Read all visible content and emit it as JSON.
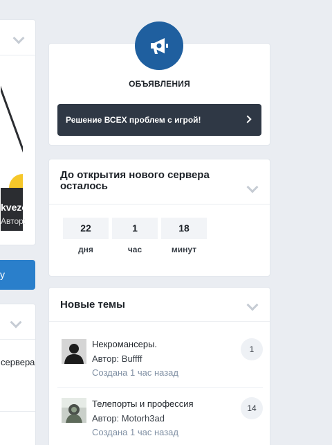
{
  "left_column": {
    "top_card": {
      "caption": "kvezo",
      "subcaption": "Автор:"
    },
    "button": {
      "label": "у"
    },
    "bottom_card": {
      "line1": "сервера",
      "line2": ""
    }
  },
  "announcements": {
    "icon": "megaphone-icon",
    "title": "ОБЪЯВЛЕНИЯ",
    "item_label": "Решение ВСЕХ проблем с игрой!",
    "colors": {
      "badge": "#1f5f9f",
      "bar": "#2f3845"
    }
  },
  "countdown": {
    "title": "До открытия нового сервера осталось",
    "units": [
      {
        "value": "22",
        "label": "дня"
      },
      {
        "value": "1",
        "label": "час"
      },
      {
        "value": "18",
        "label": "минут"
      }
    ]
  },
  "new_topics": {
    "title": "Новые темы",
    "items": [
      {
        "title": "Некромансеры.",
        "author": "Автор: Buffff",
        "time": "Создана 1 час назад",
        "replies": "1"
      },
      {
        "title": "Телепорты и профессия",
        "author": "Автор: Motorh3ad",
        "time": "Создана 1 час назад",
        "replies": "14"
      }
    ]
  }
}
